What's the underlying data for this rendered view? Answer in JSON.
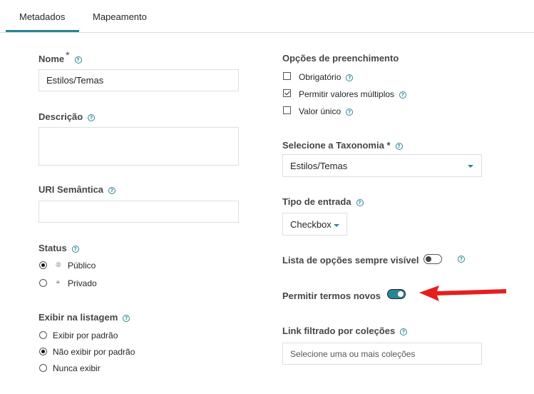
{
  "tabs": [
    {
      "label": "Metadados",
      "active": true
    },
    {
      "label": "Mapeamento",
      "active": false
    }
  ],
  "left": {
    "name": {
      "label": "Nome",
      "required_mark": "*",
      "value": "Estilos/Temas"
    },
    "description": {
      "label": "Descrição",
      "value": ""
    },
    "uri": {
      "label": "URI Semântica",
      "value": ""
    },
    "status": {
      "label": "Status",
      "options": [
        {
          "label": "Público",
          "icon": "globe-icon",
          "selected": true
        },
        {
          "label": "Privado",
          "icon": "lock-icon",
          "selected": false
        }
      ]
    },
    "listing": {
      "label": "Exibir na listagem",
      "options": [
        {
          "label": "Exibir por padrão",
          "selected": false
        },
        {
          "label": "Não exibir por padrão",
          "selected": true
        },
        {
          "label": "Nunca exibir",
          "selected": false
        }
      ]
    }
  },
  "right": {
    "fill_options": {
      "label": "Opções de preenchimento",
      "options": [
        {
          "label": "Obrigatório",
          "checked": false
        },
        {
          "label": "Permitir valores múltiplos",
          "checked": true
        },
        {
          "label": "Valor único",
          "checked": false
        }
      ]
    },
    "taxonomy": {
      "label": "Selecione a Taxonomia",
      "required_mark": "*",
      "value": "Estilos/Temas"
    },
    "input_type": {
      "label": "Tipo de entrada",
      "value": "Checkbox"
    },
    "always_visible": {
      "label": "Lista de opções sempre visível",
      "on": false
    },
    "allow_new_terms": {
      "label": "Permitir termos novos",
      "on": true
    },
    "collections_link": {
      "label": "Link filtrado por coleções",
      "placeholder": "Selecione uma ou mais coleções"
    }
  },
  "colors": {
    "accent": "#298596",
    "arrow": "#e61e1e"
  }
}
